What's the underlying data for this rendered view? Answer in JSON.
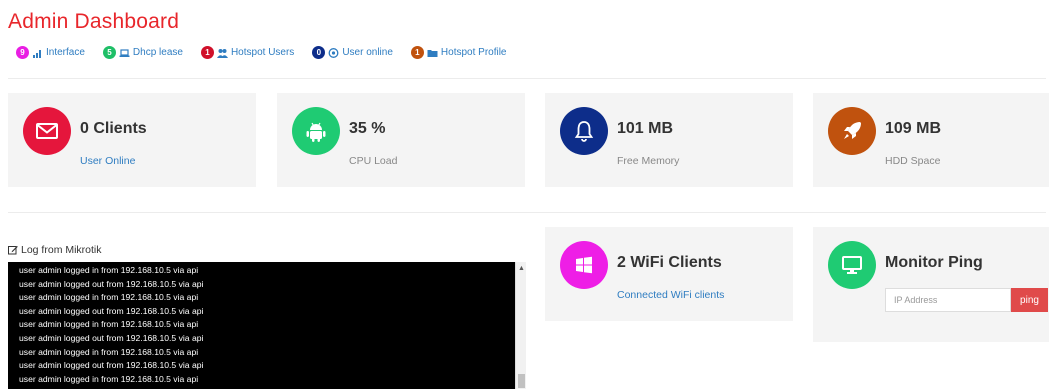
{
  "page": {
    "title": "Admin Dashboard"
  },
  "quicklinks": [
    {
      "count": "9",
      "label": "Interface",
      "color": "#e91ee3",
      "icon": "signal-icon"
    },
    {
      "count": "5",
      "label": "Dhcp lease",
      "color": "#1fbf67",
      "icon": "laptop-icon"
    },
    {
      "count": "1",
      "label": "Hotspot Users",
      "color": "#d0102a",
      "icon": "users-icon"
    },
    {
      "count": "0",
      "label": "User online",
      "color": "#0d2d8a",
      "icon": "user-circle-icon"
    },
    {
      "count": "1",
      "label": "Hotspot Profile",
      "color": "#c0520e",
      "icon": "folder-icon"
    }
  ],
  "stats": {
    "clients": {
      "value": "0 Clients",
      "label": "User Online",
      "color": "#e5163c",
      "icon": "envelope-icon"
    },
    "cpu": {
      "value": "35 %",
      "label": "CPU Load",
      "color": "#1fcb73",
      "icon": "android-icon"
    },
    "memory": {
      "value": "101 MB",
      "label": "Free Memory",
      "color": "#0d2d8a",
      "icon": "bell-icon"
    },
    "hdd": {
      "value": "109 MB",
      "label": "HDD Space",
      "color": "#c0520e",
      "icon": "rocket-icon"
    },
    "wifi": {
      "value": "2 WiFi Clients",
      "label": "Connected WiFi clients",
      "color": "#ee1ee6",
      "icon": "windows-icon"
    }
  },
  "log": {
    "title": "Log from Mikrotik",
    "lines": [
      "user admin logged in from 192.168.10.5 via api",
      "user admin logged out from 192.168.10.5 via api",
      "user admin logged in from 192.168.10.5 via api",
      "user admin logged out from 192.168.10.5 via api",
      "user admin logged in from 192.168.10.5 via api",
      "user admin logged out from 192.168.10.5 via api",
      "user admin logged in from 192.168.10.5 via api",
      "user admin logged out from 192.168.10.5 via api",
      "user admin logged in from 192.168.10.5 via api"
    ]
  },
  "ping": {
    "title": "Monitor Ping",
    "placeholder": "IP Address",
    "button_label": "ping",
    "color": "#1fcb73",
    "icon": "monitor-icon"
  }
}
